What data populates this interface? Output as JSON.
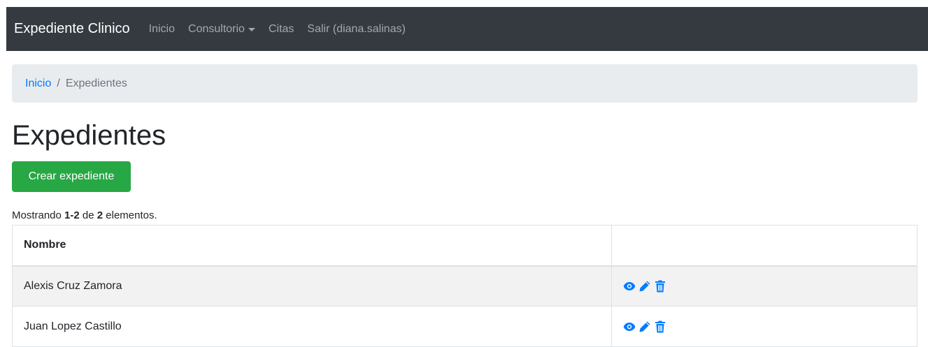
{
  "navbar": {
    "brand": "Expediente Clinico",
    "links": [
      {
        "label": "Inicio"
      },
      {
        "label": "Consultorio"
      },
      {
        "label": "Citas"
      },
      {
        "label": "Salir (diana.salinas)"
      }
    ]
  },
  "breadcrumb": {
    "home": "Inicio",
    "separator": "/",
    "current": "Expedientes"
  },
  "page": {
    "title": "Expedientes",
    "create_button": "Crear expediente"
  },
  "summary": {
    "prefix": "Mostrando",
    "range": "1-2",
    "middle": "de",
    "total": "2",
    "suffix": "elementos."
  },
  "table": {
    "headers": [
      "Nombre",
      ""
    ],
    "rows": [
      {
        "name": "Alexis Cruz Zamora",
        "actions": [
          "view-icon",
          "edit-icon",
          "delete-icon"
        ]
      },
      {
        "name": "Juan Lopez Castillo",
        "actions": [
          "view-icon",
          "edit-icon",
          "delete-icon"
        ]
      }
    ]
  },
  "colors": {
    "navbar_bg": "#343a40",
    "link": "#007bff",
    "success": "#28a745",
    "breadcrumb_bg": "#e9ecef"
  }
}
